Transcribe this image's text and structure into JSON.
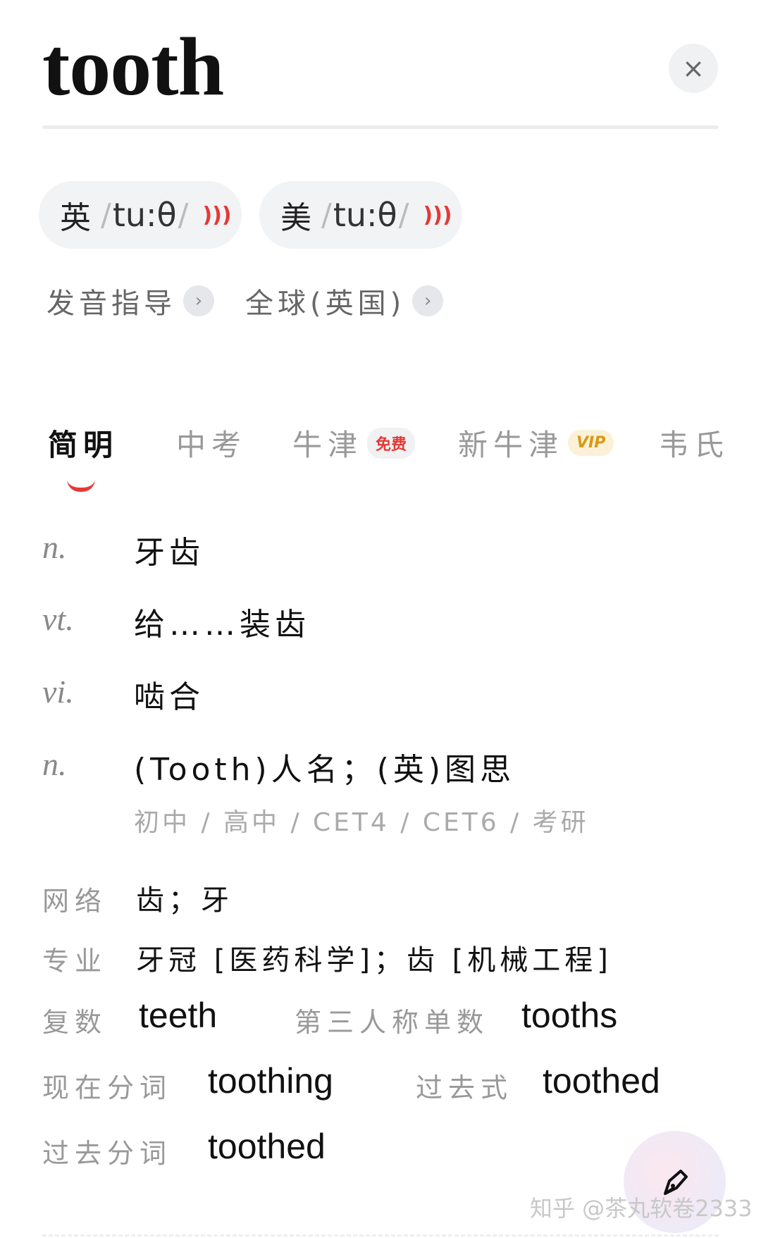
{
  "word": "tooth",
  "close_symbol": "×",
  "pronunciations": [
    {
      "region": "英",
      "ipa": "tu:θ",
      "slash": "/",
      "speaker": "🔊"
    },
    {
      "region": "美",
      "ipa": "tu:θ",
      "slash": "/",
      "speaker": "🔊"
    }
  ],
  "guides": [
    {
      "label": "发音指导",
      "chevron": "›"
    },
    {
      "label": "全球(英国)",
      "chevron": "›"
    }
  ],
  "tabs": [
    {
      "label": "简明",
      "active": true
    },
    {
      "label": "中考"
    },
    {
      "label": "牛津",
      "badge": "免费"
    },
    {
      "label": "新牛津",
      "badge": "VIP"
    },
    {
      "label": "韦氏"
    }
  ],
  "definitions": [
    {
      "pos": "n.",
      "meaning": "牙齿"
    },
    {
      "pos": "vt.",
      "meaning": "给……装齿"
    },
    {
      "pos": "vi.",
      "meaning": "啮合"
    },
    {
      "pos": "n.",
      "meaning": "(Tooth)人名；(英)图思"
    }
  ],
  "levels": "初中 / 高中 / CET4 / CET6 / 考研",
  "web": {
    "label": "网络",
    "value": "齿；牙"
  },
  "professional": {
    "label": "专业",
    "value": "牙冠 [医药科学]；齿 [机械工程]"
  },
  "forms": {
    "plural_label": "复数",
    "plural": "teeth",
    "third_label": "第三人称单数",
    "third": "tooths",
    "present_participle_label": "现在分词",
    "present_participle": "toothing",
    "past_label": "过去式",
    "past": "toothed",
    "past_participle_label": "过去分词",
    "past_participle": "toothed"
  },
  "fab_icon": "pen-icon",
  "watermark": "知乎 @茶丸软卷2333",
  "colors": {
    "accent": "#e53935",
    "vip": "#d89a12"
  }
}
